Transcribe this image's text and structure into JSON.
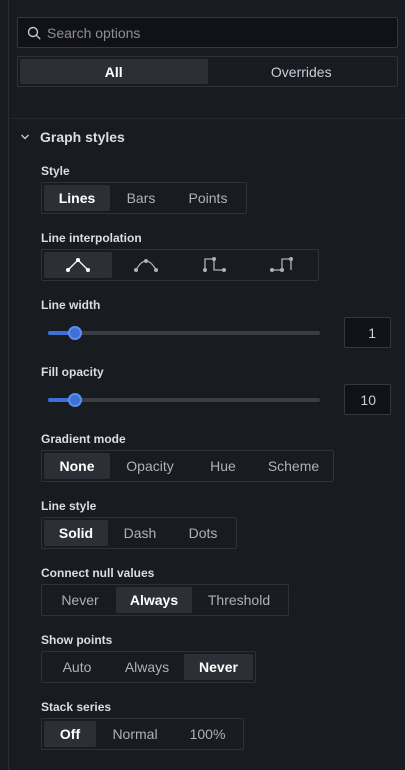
{
  "search": {
    "placeholder": "Search options",
    "value": ""
  },
  "tabs": [
    {
      "label": "All",
      "active": true
    },
    {
      "label": "Overrides",
      "active": false
    }
  ],
  "section": {
    "title": "Graph styles",
    "expanded": true
  },
  "style": {
    "label": "Style",
    "options": [
      "Lines",
      "Bars",
      "Points"
    ],
    "selected": "Lines"
  },
  "line_interpolation": {
    "label": "Line interpolation",
    "options": [
      "linear-icon",
      "smooth-icon",
      "step-before-icon",
      "step-after-icon"
    ],
    "selected": "linear-icon"
  },
  "line_width": {
    "label": "Line width",
    "value": "1",
    "fraction": 0.1
  },
  "fill_opacity": {
    "label": "Fill opacity",
    "value": "10",
    "fraction": 0.1
  },
  "gradient_mode": {
    "label": "Gradient mode",
    "options": [
      "None",
      "Opacity",
      "Hue",
      "Scheme"
    ],
    "selected": "None"
  },
  "line_style": {
    "label": "Line style",
    "options": [
      "Solid",
      "Dash",
      "Dots"
    ],
    "selected": "Solid"
  },
  "connect_null": {
    "label": "Connect null values",
    "options": [
      "Never",
      "Always",
      "Threshold"
    ],
    "selected": "Always"
  },
  "show_points": {
    "label": "Show points",
    "options": [
      "Auto",
      "Always",
      "Never"
    ],
    "selected": "Never"
  },
  "stack_series": {
    "label": "Stack series",
    "options": [
      "Off",
      "Normal",
      "100%"
    ],
    "selected": "Off"
  },
  "colors": {
    "accent": "#3d71d9",
    "background": "#181b1f",
    "active_option": "#2c3036"
  }
}
